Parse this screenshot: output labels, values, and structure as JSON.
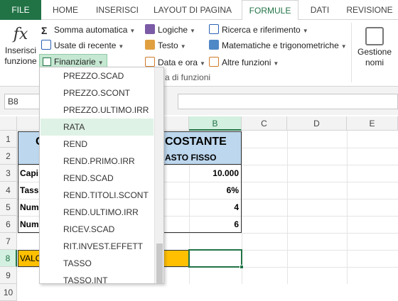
{
  "tabs": [
    "FILE",
    "HOME",
    "INSERISCI",
    "LAYOUT DI PAGINA",
    "FORMULE",
    "DATI",
    "REVISIONE"
  ],
  "ribbon": {
    "insert_function": "Inserisci funzione",
    "insert_function_l1": "Inserisci",
    "insert_function_l2": "funzione",
    "autosum": "Somma automatica",
    "recent": "Usate di recente",
    "financial": "Finanziarie",
    "logical": "Logiche",
    "text": "Testo",
    "datetime": "Data e ora",
    "lookup": "Ricerca e riferimento",
    "math": "Matematiche e trigonometriche",
    "more": "Altre funzioni",
    "group_label": "a di funzioni",
    "names_l1": "Gestione",
    "names_l2": "nomi"
  },
  "formula_bar": {
    "name_box": "B8",
    "formula": ""
  },
  "columns": [
    "A",
    "B",
    "C",
    "D",
    "E"
  ],
  "rows": [
    "1",
    "2",
    "3",
    "4",
    "5",
    "6",
    "7",
    "8",
    "9",
    "10"
  ],
  "selected_cell": {
    "column": "B",
    "row": "8"
  },
  "cells": {
    "a1": "C",
    "b1": "COSTANTE",
    "b2": "ASTO FISSO",
    "a3": "Capi",
    "b3": "10.000",
    "a4": "Tass",
    "b4": "6%",
    "a5": "Num",
    "b5": "4",
    "a6": "Num",
    "b6": "6",
    "a8": "VALO"
  },
  "dropdown": {
    "items": [
      "PREZZO.SCAD",
      "PREZZO.SCONT",
      "PREZZO.ULTIMO.IRR",
      "RATA",
      "REND",
      "REND.PRIMO.IRR",
      "REND.SCAD",
      "REND.TITOLI.SCONT",
      "REND.ULTIMO.IRR",
      "RICEV.SCAD",
      "RIT.INVEST.EFFETT",
      "TASSO",
      "TASSO.INT"
    ],
    "highlighted": "RATA"
  },
  "colors": {
    "excel_green": "#217346",
    "header_blue": "#bdd7ee",
    "value_orange": "#ffc000"
  }
}
